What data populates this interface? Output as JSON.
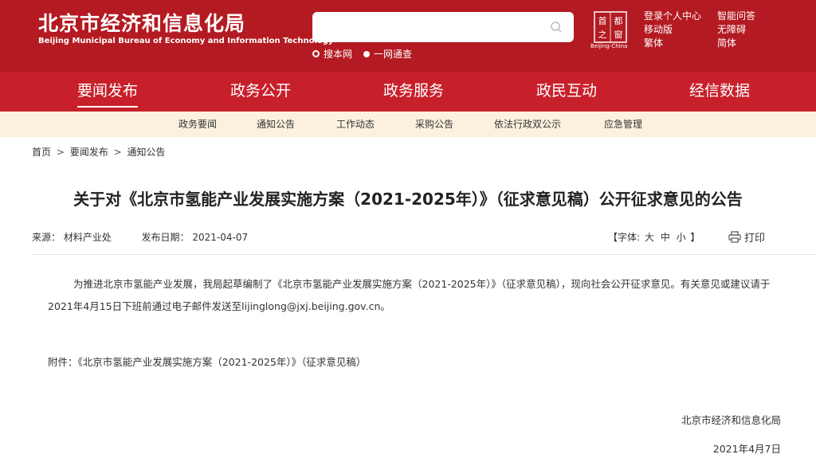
{
  "header": {
    "logo_cn": "北京市经济和信息化局",
    "logo_en": "Beijing Municipal Bureau of Economy and Information Technology",
    "search": {
      "placeholder": "",
      "opt_site": "搜本网",
      "opt_all": "一网通查"
    },
    "seal": {
      "chars": [
        "首",
        "都",
        "之",
        "窗"
      ],
      "caption": "Beijing-China"
    },
    "links_col1": [
      "登录个人中心",
      "移动版",
      "繁体"
    ],
    "links_col2": [
      "智能问答",
      "无障碍",
      "简体"
    ]
  },
  "nav": [
    "要闻发布",
    "政务公开",
    "政务服务",
    "政民互动",
    "经信数据"
  ],
  "subnav": [
    "政务要闻",
    "通知公告",
    "工作动态",
    "采购公告",
    "依法行政双公示",
    "应急管理"
  ],
  "breadcrumb": [
    "首页",
    "要闻发布",
    "通知公告"
  ],
  "breadcrumb_sep": ">",
  "article": {
    "title": "关于对《北京市氢能产业发展实施方案（2021-2025年）》（征求意见稿）公开征求意见的公告",
    "source_label": "来源：",
    "source": "材料产业处",
    "date_label": "发布日期：",
    "date": "2021-04-07",
    "font_prefix": "【字体:",
    "font_sizes": [
      "大",
      "中",
      "小"
    ],
    "font_suffix": "】",
    "print_label": "打印",
    "para1": "为推进北京市氢能产业发展，我局起草编制了《北京市氢能产业发展实施方案（2021-2025年）》（征求意见稿），现向社会公开征求意见。有关意见或建议请于2021年4月15日下班前通过电子邮件发送至lijinglong@jxj.beijing.gov.cn。",
    "attachment": "附件：《北京市氢能产业发展实施方案（2021-2025年）》（征求意见稿）",
    "sign_org": "北京市经济和信息化局",
    "sign_date": "2021年4月7日"
  },
  "colors": {
    "header_red": "#b41a22",
    "nav_red": "#c8202b",
    "subnav_bg": "#fcf1df"
  }
}
